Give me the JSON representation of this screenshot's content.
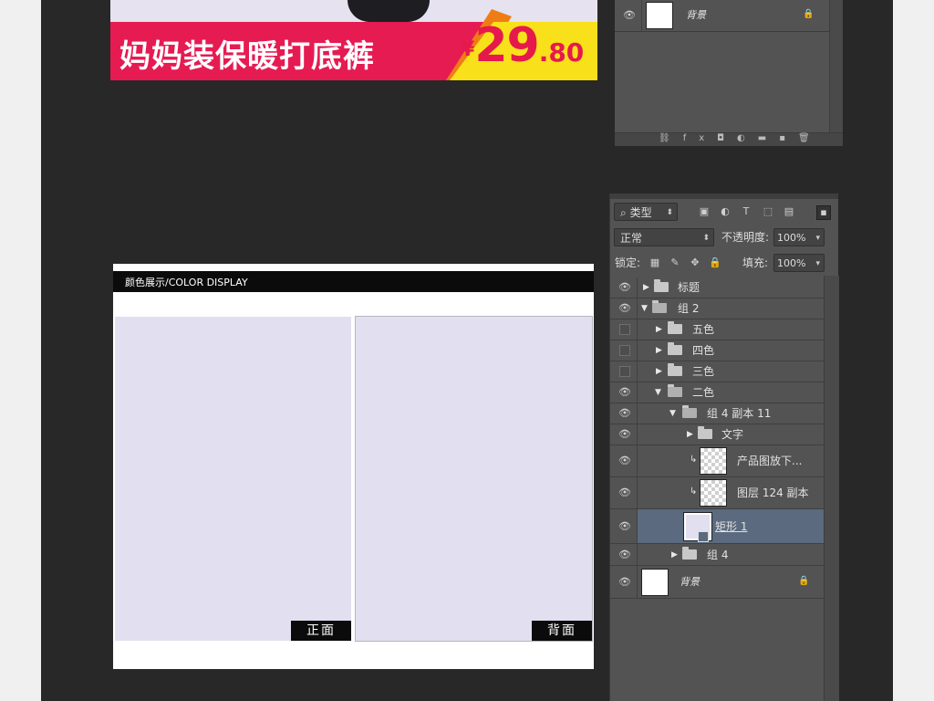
{
  "banner": {
    "title": "妈妈装保暖打底裤",
    "currency": "¥",
    "price_int": "29",
    "price_dec": ".80"
  },
  "top_panel": {
    "background_layer": "背景"
  },
  "document": {
    "header": "颜色展示/COLOR DISPLAY",
    "front_label": "正面",
    "back_label": "背面",
    "swatch_color": "#e1dff0"
  },
  "layers_panel": {
    "filter_type": "类型",
    "blend_mode": "正常",
    "opacity_label": "不透明度:",
    "opacity_value": "100%",
    "lock_label": "锁定:",
    "fill_label": "填充:",
    "fill_value": "100%",
    "layers": [
      {
        "name": "标题",
        "kind": "group",
        "expanded": false,
        "visible": true
      },
      {
        "name": "组 2",
        "kind": "group",
        "expanded": true,
        "visible": true
      },
      {
        "name": "五色",
        "kind": "group",
        "expanded": false,
        "visible": false
      },
      {
        "name": "四色",
        "kind": "group",
        "expanded": false,
        "visible": false
      },
      {
        "name": "三色",
        "kind": "group",
        "expanded": false,
        "visible": false
      },
      {
        "name": "二色",
        "kind": "group",
        "expanded": true,
        "visible": true
      },
      {
        "name": "组 4 副本 11",
        "kind": "group",
        "expanded": true,
        "visible": true
      },
      {
        "name": "文字",
        "kind": "group",
        "expanded": false,
        "visible": true
      },
      {
        "name": "产品图放下...",
        "kind": "layer",
        "clipped": true,
        "visible": true
      },
      {
        "name": "图层 124 副本",
        "kind": "layer",
        "clipped": true,
        "visible": true
      },
      {
        "name": "矩形 1",
        "kind": "shape",
        "selected": true,
        "visible": true
      },
      {
        "name": "组 4",
        "kind": "group",
        "expanded": false,
        "visible": true
      },
      {
        "name": "背景",
        "kind": "background",
        "locked": true,
        "visible": true
      }
    ]
  },
  "colors": {
    "banner_red": "#e51b52",
    "banner_yellow": "#f8e01a",
    "selected_layer": "#5b6a7e"
  }
}
